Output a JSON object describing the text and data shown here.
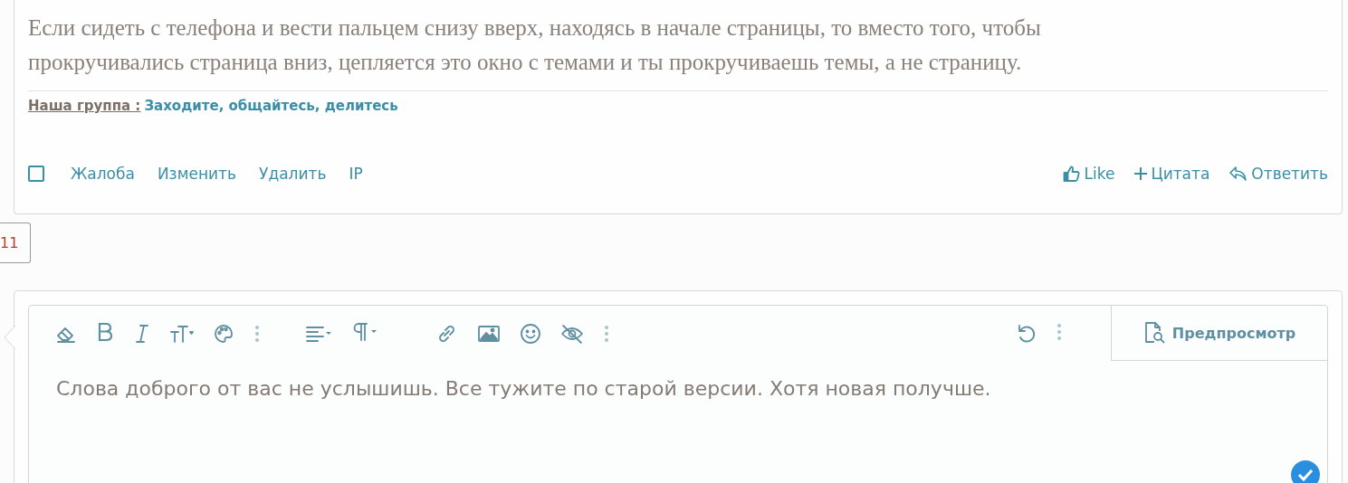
{
  "post": {
    "body": [
      "Если сидеть с телефона и вести пальцем снизу вверх, находясь в начале страницы, то вместо того, чтобы",
      "прокручивались страница вниз, цепляется это окно с темами и ты прокручиваешь темы, а не страницу."
    ],
    "signature": {
      "label": "Наша группа :",
      "link": "Заходите, общайтесь, делитесь"
    },
    "select": {
      "checked": false
    },
    "actions_left": [
      {
        "label": "Жалоба"
      },
      {
        "label": "Изменить"
      },
      {
        "label": "Удалить"
      },
      {
        "label": "IP"
      }
    ],
    "actions_right": [
      {
        "kind": "like",
        "label": "Like"
      },
      {
        "kind": "quote",
        "label": "Цитата"
      },
      {
        "kind": "reply",
        "label": "Ответить"
      }
    ]
  },
  "pagination": {
    "page": "11"
  },
  "editor": {
    "preview": "Предпросмотр",
    "value": "Слова доброго от вас не услышишь. Все тужите по старой версии. Хотя новая получше."
  }
}
